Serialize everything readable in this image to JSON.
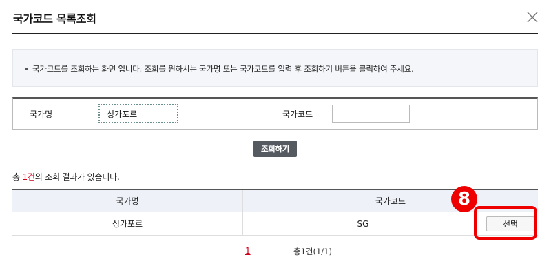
{
  "dialog": {
    "title": "국가코드 목록조회",
    "close_icon": "close-icon"
  },
  "notice": {
    "text": "국가코드를 조회하는 화면 입니다. 조회를 원하시는 국가명 또는 국가코드를 입력 후 조회하기 버튼을 클릭하여 주세요."
  },
  "search": {
    "country_name_label": "국가명",
    "country_name_value": "싱가포르",
    "country_code_label": "국가코드",
    "country_code_value": "",
    "search_button": "조회하기"
  },
  "result": {
    "prefix": "총 ",
    "count": "1건",
    "suffix": "의 조회 결과가 있습니다."
  },
  "table": {
    "headers": [
      "국가명",
      "국가코드"
    ],
    "rows": [
      {
        "country_name": "싱가포르",
        "country_code": "SG",
        "action": "선택"
      }
    ]
  },
  "annotation": {
    "step_number": "8",
    "color": "#ee0000"
  },
  "pagination": {
    "current_page": "1",
    "total": "총1건(1/1)"
  }
}
